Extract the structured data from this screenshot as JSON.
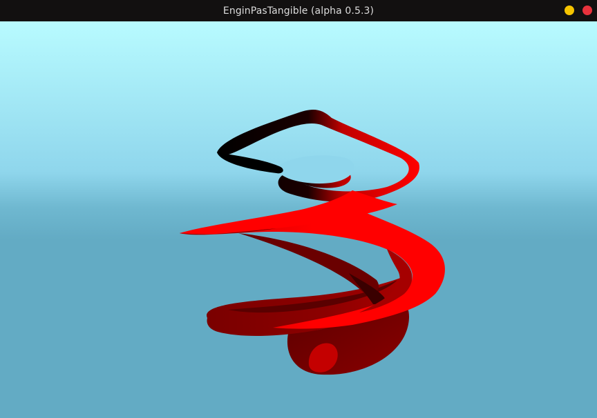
{
  "window": {
    "title": "EnginPasTangible (alpha 0.5.3)"
  },
  "controls": {
    "minimize_color": "#f5c400",
    "close_color": "#e8323c"
  },
  "scene": {
    "sky_top": "#b8fbff",
    "sky_mid": "#8fd6ec",
    "ground": "#63abc4",
    "object_color": "#ff0000",
    "object_shadow": "#5a0000",
    "object": "red-helix-ribbon"
  }
}
